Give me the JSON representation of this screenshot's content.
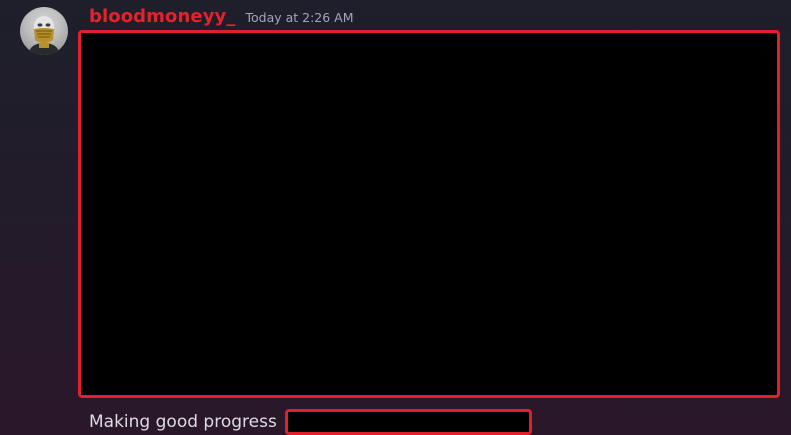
{
  "message": {
    "username": "bloodmoneyy_",
    "timestamp": "Today at 2:26 AM",
    "text": "Making good progress"
  },
  "colors": {
    "username": "#e8202a",
    "highlight_border": "#e21f2a",
    "redaction_fill": "#000000",
    "background_top": "#1e1f2b",
    "background_bottom": "#2a1729",
    "timestamp": "#a3a6b4",
    "message_text": "#dcdde1"
  },
  "icons": {
    "avatar": "masked-figure-avatar"
  }
}
